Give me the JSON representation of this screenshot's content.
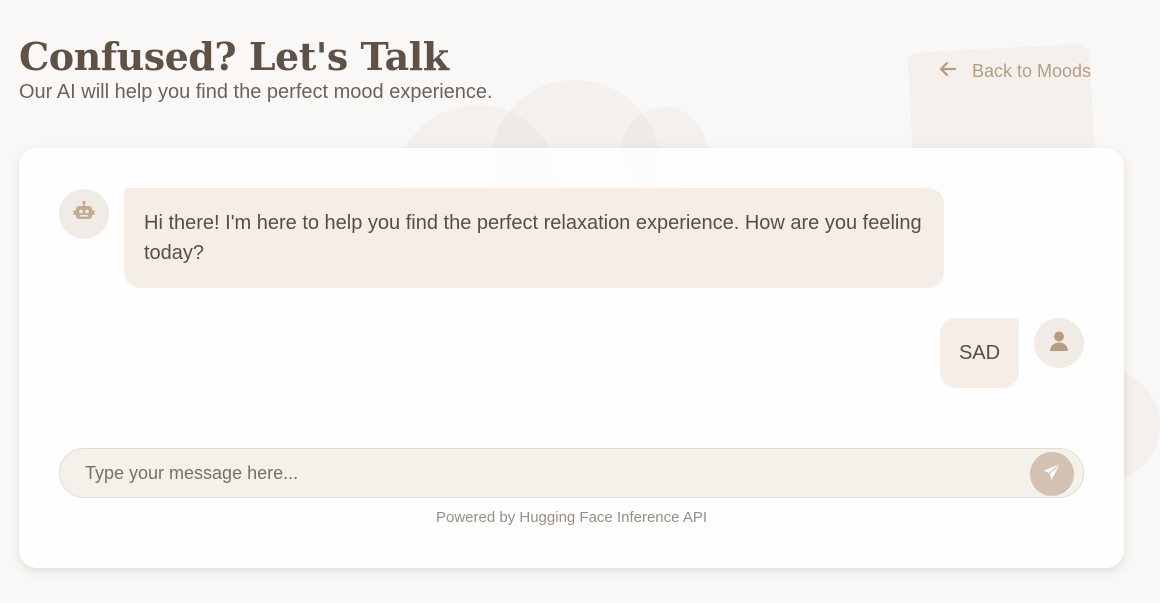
{
  "header": {
    "title": "Confused? Let's Talk",
    "subtitle": "Our AI will help you find the perfect mood experience.",
    "back_link": {
      "label": "Back to Moods",
      "icon": "arrow-left-icon"
    }
  },
  "chat": {
    "messages": [
      {
        "sender": "bot",
        "avatar_icon": "robot-icon",
        "text": "Hi there! I'm here to help you find the perfect relaxation experience. How are you feeling today?"
      },
      {
        "sender": "user",
        "avatar_icon": "user-icon",
        "text": "SAD"
      }
    ],
    "input": {
      "value": "",
      "placeholder": "Type your message here..."
    },
    "send_icon": "paper-plane-icon",
    "footer": "Powered by Hugging Face Inference API"
  },
  "colors": {
    "background": "#faf8f6",
    "accent": "#b79c84",
    "send_button": "#d3c1b1",
    "bubble": "#f3ede5"
  }
}
